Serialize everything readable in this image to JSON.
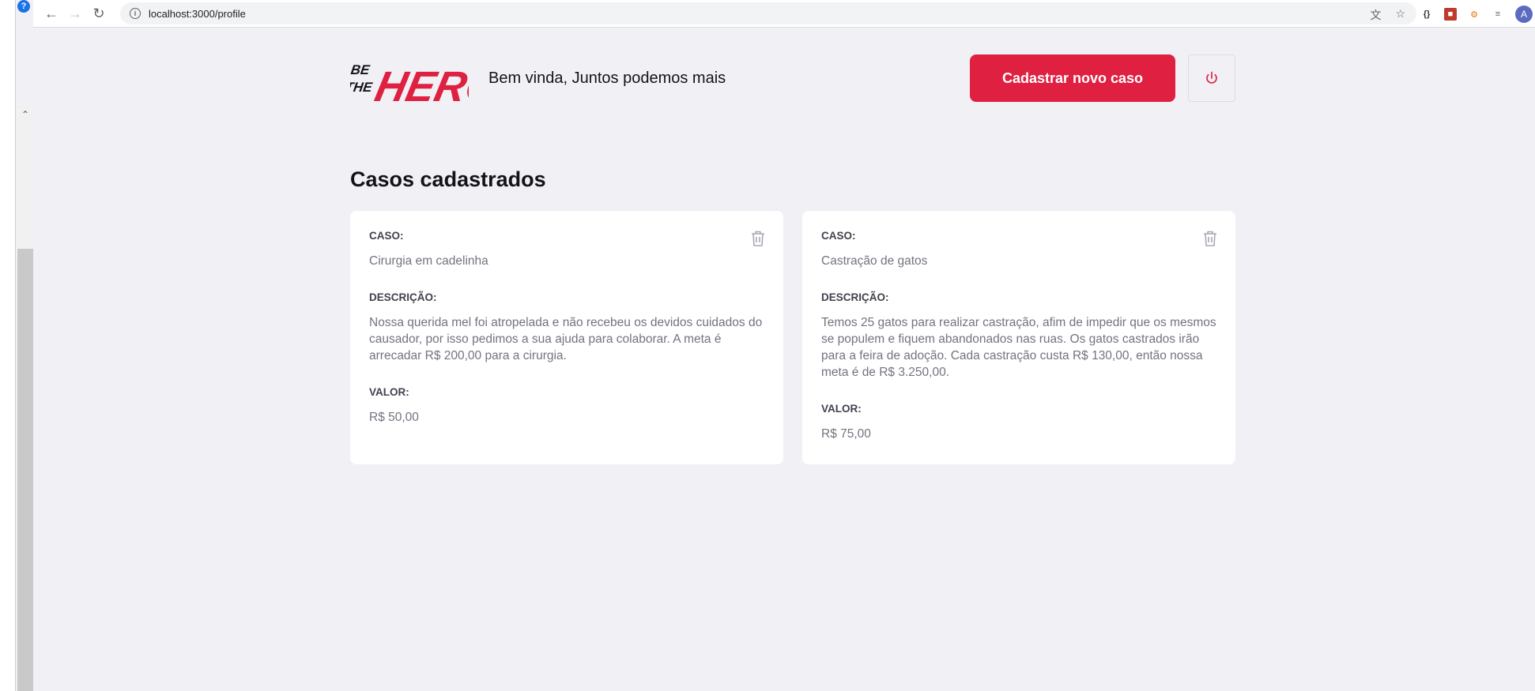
{
  "browser": {
    "url": "localhost:3000/profile",
    "profile_initial": "A"
  },
  "header": {
    "logo_text": "BE THE HERO",
    "welcome": "Bem vinda, Juntos podemos mais",
    "new_case_label": "Cadastrar novo caso"
  },
  "section_title": "Casos cadastrados",
  "labels": {
    "caso": "CASO:",
    "descricao": "DESCRIÇÃO:",
    "valor": "VALOR:"
  },
  "cases": [
    {
      "title": "Cirurgia em cadelinha",
      "description": "Nossa querida mel foi atropelada e não recebeu os devidos cuidados do causador, por isso pedimos a sua ajuda para colaborar. A meta é arrecadar R$ 200,00 para a cirurgia.",
      "value": "R$ 50,00"
    },
    {
      "title": "Castração de gatos",
      "description": "Temos 25 gatos para realizar castração, afim de impedir que os mesmos se populem e fiquem abandonados nas ruas. Os gatos castrados irão para a feira de adoção. Cada castração custa R$ 130,00, então nossa meta é de R$ 3.250,00.",
      "value": "R$ 75,00"
    }
  ],
  "colors": {
    "brand": "#e02041",
    "background": "#f0f0f5"
  }
}
